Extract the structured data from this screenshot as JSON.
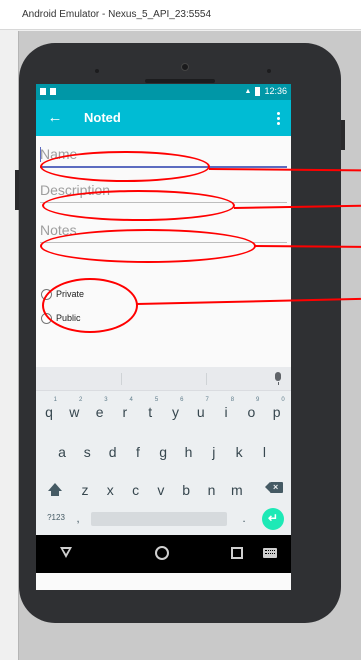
{
  "window": {
    "title": "Android Emulator - Nexus_5_API_23:5554"
  },
  "statusbar": {
    "time": "12:36"
  },
  "appbar": {
    "title": "Noted"
  },
  "form": {
    "name_placeholder": "Name",
    "description_placeholder": "Description",
    "notes_placeholder": "Notes",
    "radio_private": "Private",
    "radio_public": "Public"
  },
  "keyboard": {
    "row1": [
      {
        "key": "q",
        "hint": "1"
      },
      {
        "key": "w",
        "hint": "2"
      },
      {
        "key": "e",
        "hint": "3"
      },
      {
        "key": "r",
        "hint": "4"
      },
      {
        "key": "t",
        "hint": "5"
      },
      {
        "key": "y",
        "hint": "6"
      },
      {
        "key": "u",
        "hint": "7"
      },
      {
        "key": "i",
        "hint": "8"
      },
      {
        "key": "o",
        "hint": "9"
      },
      {
        "key": "p",
        "hint": "0"
      }
    ],
    "row2": [
      "a",
      "s",
      "d",
      "f",
      "g",
      "h",
      "j",
      "k",
      "l"
    ],
    "row3": [
      "z",
      "x",
      "c",
      "v",
      "b",
      "n",
      "m"
    ],
    "symbols_label": "?123",
    "comma_label": ",",
    "period_label": "."
  },
  "colors": {
    "statusbar": "#0097a7",
    "appbar": "#00bcd4",
    "accent": "#5c6bc0",
    "enter": "#1de9b6",
    "annotation": "#ff0000"
  }
}
